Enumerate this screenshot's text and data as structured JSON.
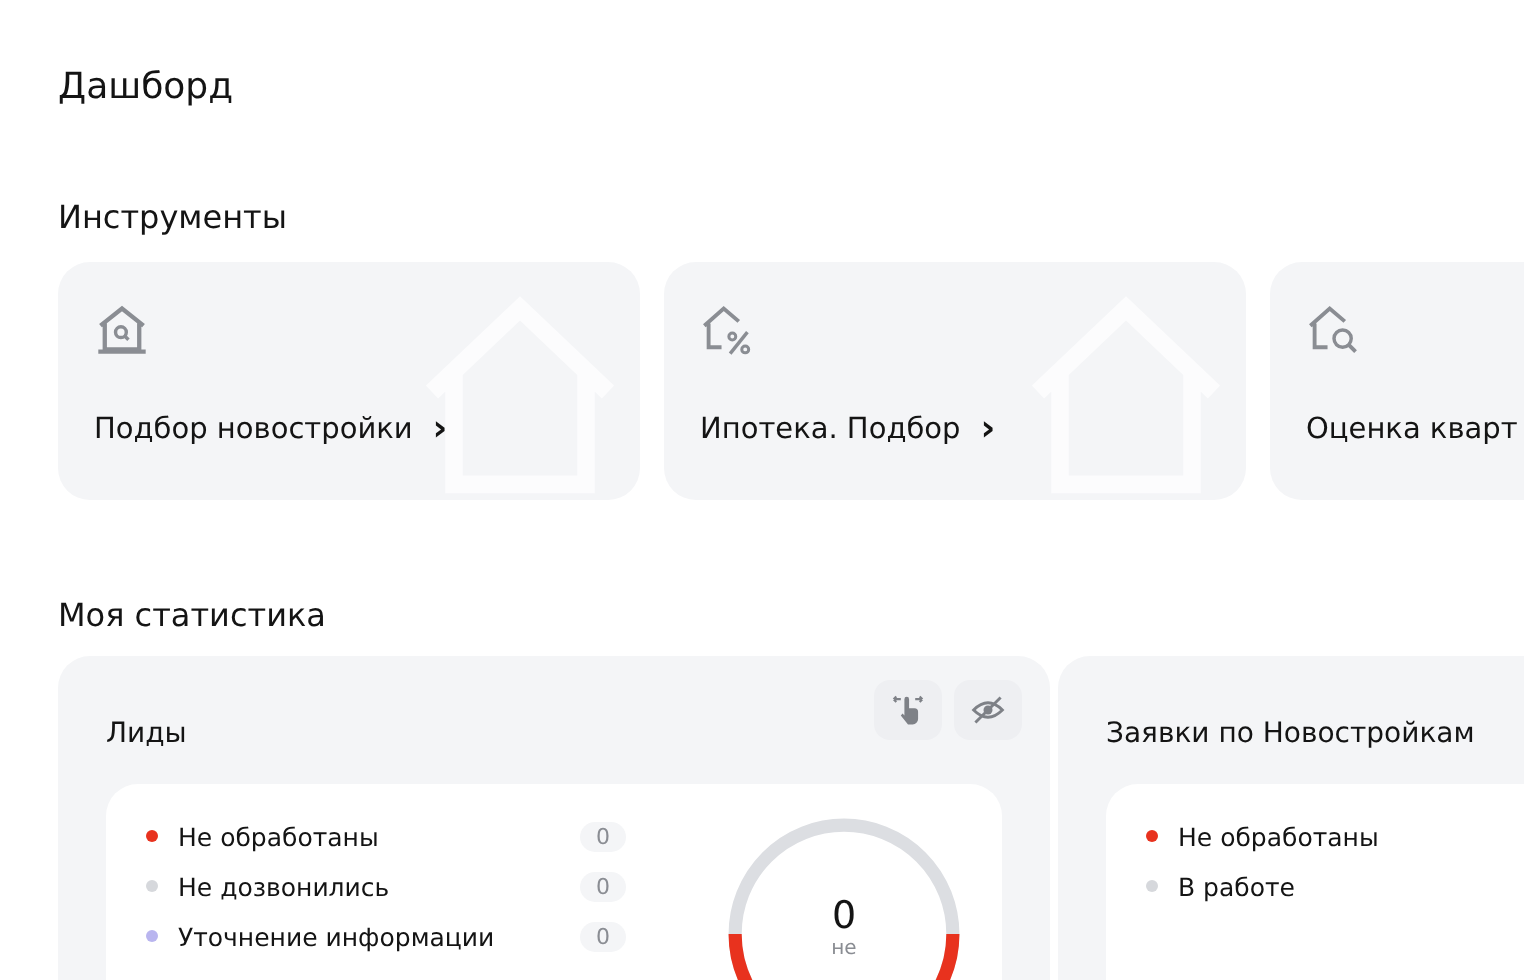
{
  "page_title": "Дашборд",
  "tools": {
    "title": "Инструменты",
    "cards": [
      {
        "kind": "search",
        "label": "Подбор новостройки",
        "arrow": "›"
      },
      {
        "kind": "percent",
        "label": "Ипотека. Подбор",
        "arrow": "›"
      },
      {
        "kind": "lens",
        "label": "Оценка кварт"
      }
    ]
  },
  "stats": {
    "title": "Моя статистика",
    "panels": [
      {
        "title": "Лиды",
        "toolbar": [
          {
            "kind": "drag"
          },
          {
            "kind": "hide"
          }
        ],
        "items": [
          {
            "label": "Не обработаны",
            "count": "0",
            "color": "#e8321e"
          },
          {
            "label": "Не дозвонились",
            "count": "0",
            "color": "#d6d8dc"
          },
          {
            "label": "Уточнение информации",
            "count": "0",
            "color": "#b9b5ef"
          }
        ],
        "gauge": {
          "value": "0",
          "caption": "не"
        }
      },
      {
        "title": "Заявки по Новостройкам",
        "items": [
          {
            "label": "Не обработаны",
            "color": "#e8321e"
          },
          {
            "label": "В работе",
            "color": "#d6d8dc"
          }
        ]
      }
    ]
  }
}
